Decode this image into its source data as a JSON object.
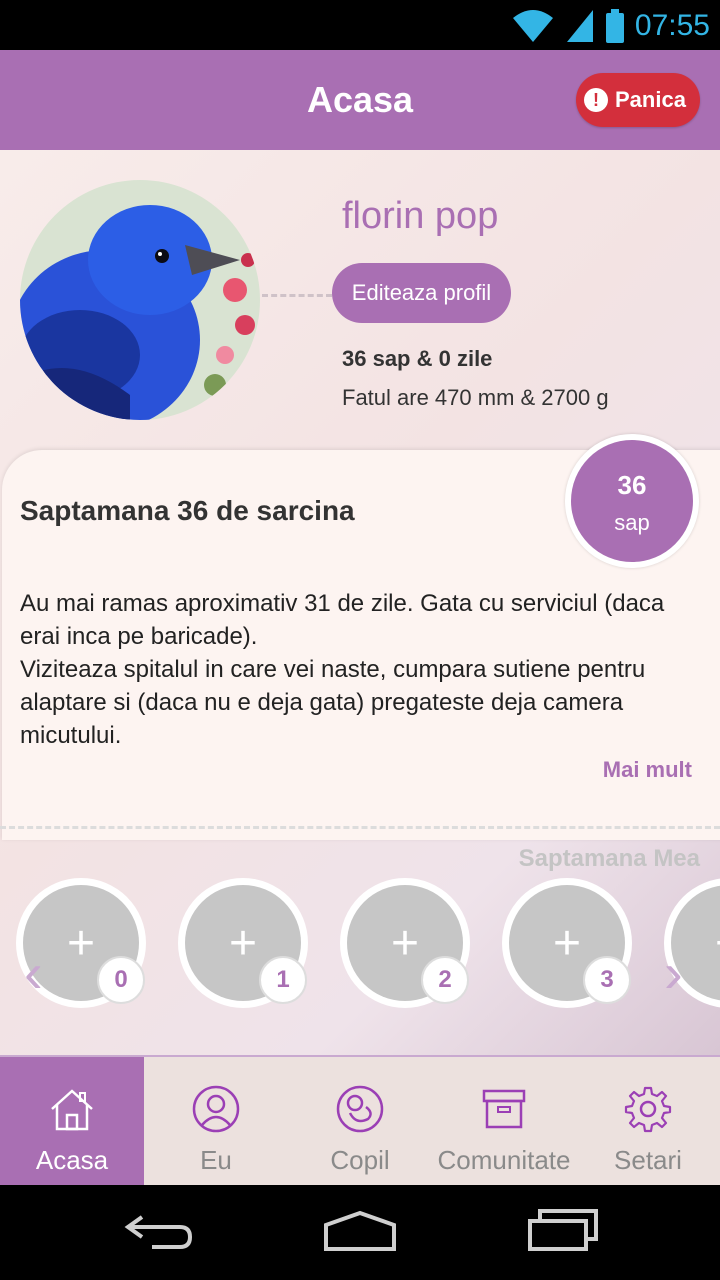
{
  "status_bar": {
    "time": "07:55",
    "icons": [
      "wifi-icon",
      "signal-icon",
      "battery-icon"
    ]
  },
  "app_bar": {
    "title": "Acasa",
    "panic_label": "Panica",
    "panic_icon": "warning-icon"
  },
  "profile": {
    "name": "florin pop",
    "edit_label": "Editeaza profil",
    "pregnancy_age": "36 sap & 0 zile",
    "fetus_info": "Fatul are 470 mm & 2700 g"
  },
  "week_card": {
    "title": "Saptamana 36 de sarcina",
    "badge_number": "36",
    "badge_unit": "sap",
    "text": "Au mai ramas aproximativ 31 de zile. Gata cu serviciul (daca erai inca pe baricade).\nViziteaza spitalul in care vei naste, cumpara sutiene pentru alaptare si (daca nu e deja gata) pregateste deja camera micutului.",
    "more_label": "Mai mult"
  },
  "my_week": {
    "label": "Saptamana Mea",
    "slots": [
      {
        "count": "0"
      },
      {
        "count": "1"
      },
      {
        "count": "2"
      },
      {
        "count": "3"
      }
    ]
  },
  "bottom_nav": {
    "tabs": [
      {
        "label": "Acasa",
        "icon": "home-icon",
        "active": true
      },
      {
        "label": "Eu",
        "icon": "user-icon",
        "active": false
      },
      {
        "label": "Copil",
        "icon": "baby-icon",
        "active": false
      },
      {
        "label": "Comunitate",
        "icon": "archive-box-icon",
        "active": false
      },
      {
        "label": "Setari",
        "icon": "gear-icon",
        "active": false
      }
    ]
  },
  "colors": {
    "accent": "#a96fb3",
    "panic": "#d32f3c",
    "status_blue": "#33b5e5"
  }
}
